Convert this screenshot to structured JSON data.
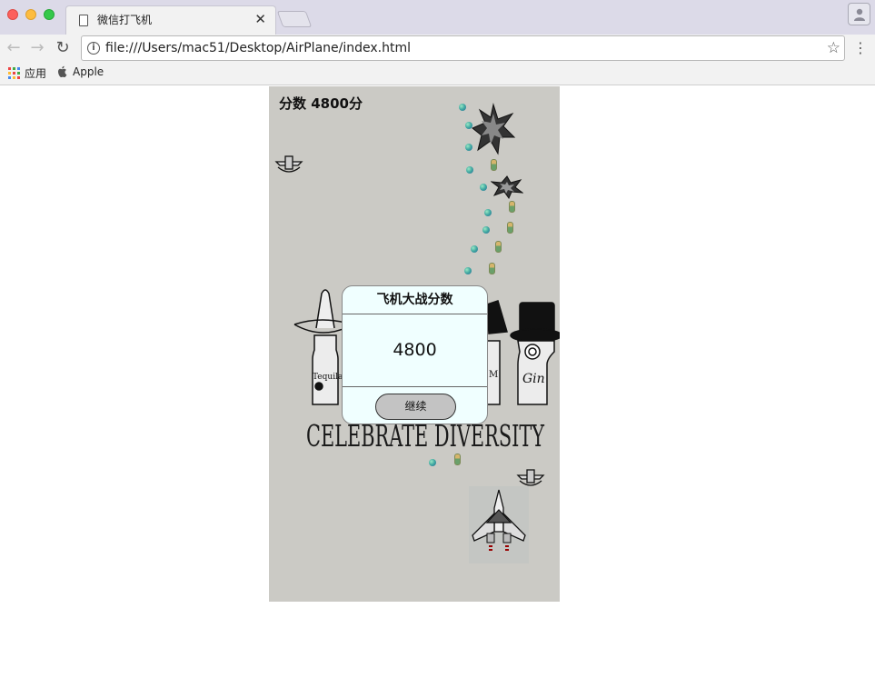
{
  "window": {
    "tab_title": "微信打飞机",
    "url": "file:///Users/mac51/Desktop/AirPlane/index.html"
  },
  "bookmarks": [
    {
      "label": "应用",
      "icon": "apps-grid-icon"
    },
    {
      "label": "Apple",
      "icon": "apple-icon"
    }
  ],
  "game": {
    "score_label": "分数 4800分",
    "background_text": "CELEBRATE DIVERSITY",
    "bottle_labels": [
      "Tequila",
      "M",
      "Gin"
    ]
  },
  "dialog": {
    "title": "飞机大战分数",
    "score": "4800",
    "continue_label": "继续"
  },
  "colors": {
    "game_background": "#cbcac5",
    "dialog_background": "#f0ffff",
    "button_background": "#c3c3c3"
  }
}
